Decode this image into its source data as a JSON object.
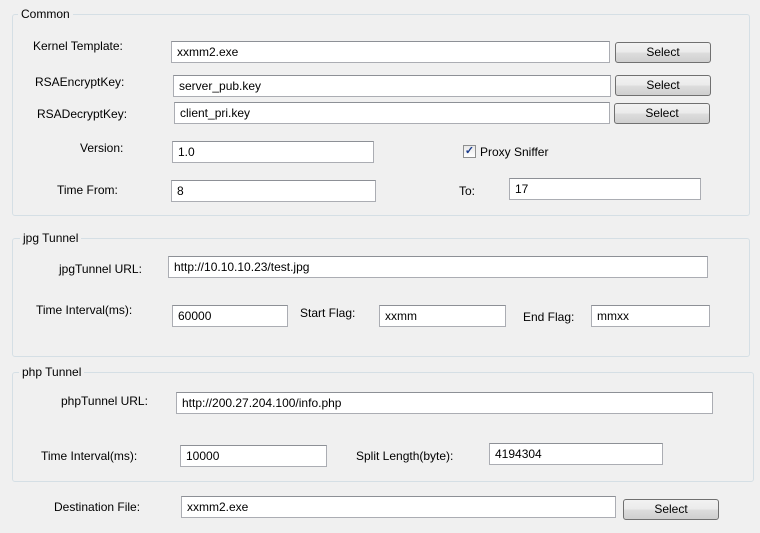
{
  "common": {
    "legend": "Common",
    "kernel_template": {
      "label": "Kernel Template:",
      "value": "xxmm2.exe",
      "button": "Select"
    },
    "rsa_encrypt_key": {
      "label": "RSAEncryptKey:",
      "value": "server_pub.key",
      "button": "Select"
    },
    "rsa_decrypt_key": {
      "label": "RSADecryptKey:",
      "value": "client_pri.key",
      "button": "Select"
    },
    "version": {
      "label": "Version:",
      "value": "1.0"
    },
    "proxy_sniffer": {
      "label": "Proxy Sniffer",
      "checked": true,
      "mark": "✓"
    },
    "time_from": {
      "label": "Time From:",
      "value": "8"
    },
    "time_to": {
      "label": "To:",
      "value": "17"
    }
  },
  "jpg_tunnel": {
    "legend": "jpg Tunnel",
    "url": {
      "label": "jpgTunnel URL:",
      "value": "http://10.10.10.23/test.jpg"
    },
    "time_interval": {
      "label": "Time Interval(ms):",
      "value": "60000"
    },
    "start_flag": {
      "label": "Start Flag:",
      "value": "xxmm"
    },
    "end_flag": {
      "label": "End Flag:",
      "value": "mmxx"
    }
  },
  "php_tunnel": {
    "legend": "php Tunnel",
    "url": {
      "label": "phpTunnel URL:",
      "value": "http://200.27.204.100/info.php"
    },
    "time_interval": {
      "label": "Time Interval(ms):",
      "value": "10000"
    },
    "split_length": {
      "label": "Split Length(byte):",
      "value": "4194304"
    }
  },
  "destination": {
    "label": "Destination File:",
    "value": "xxmm2.exe",
    "button": "Select"
  }
}
